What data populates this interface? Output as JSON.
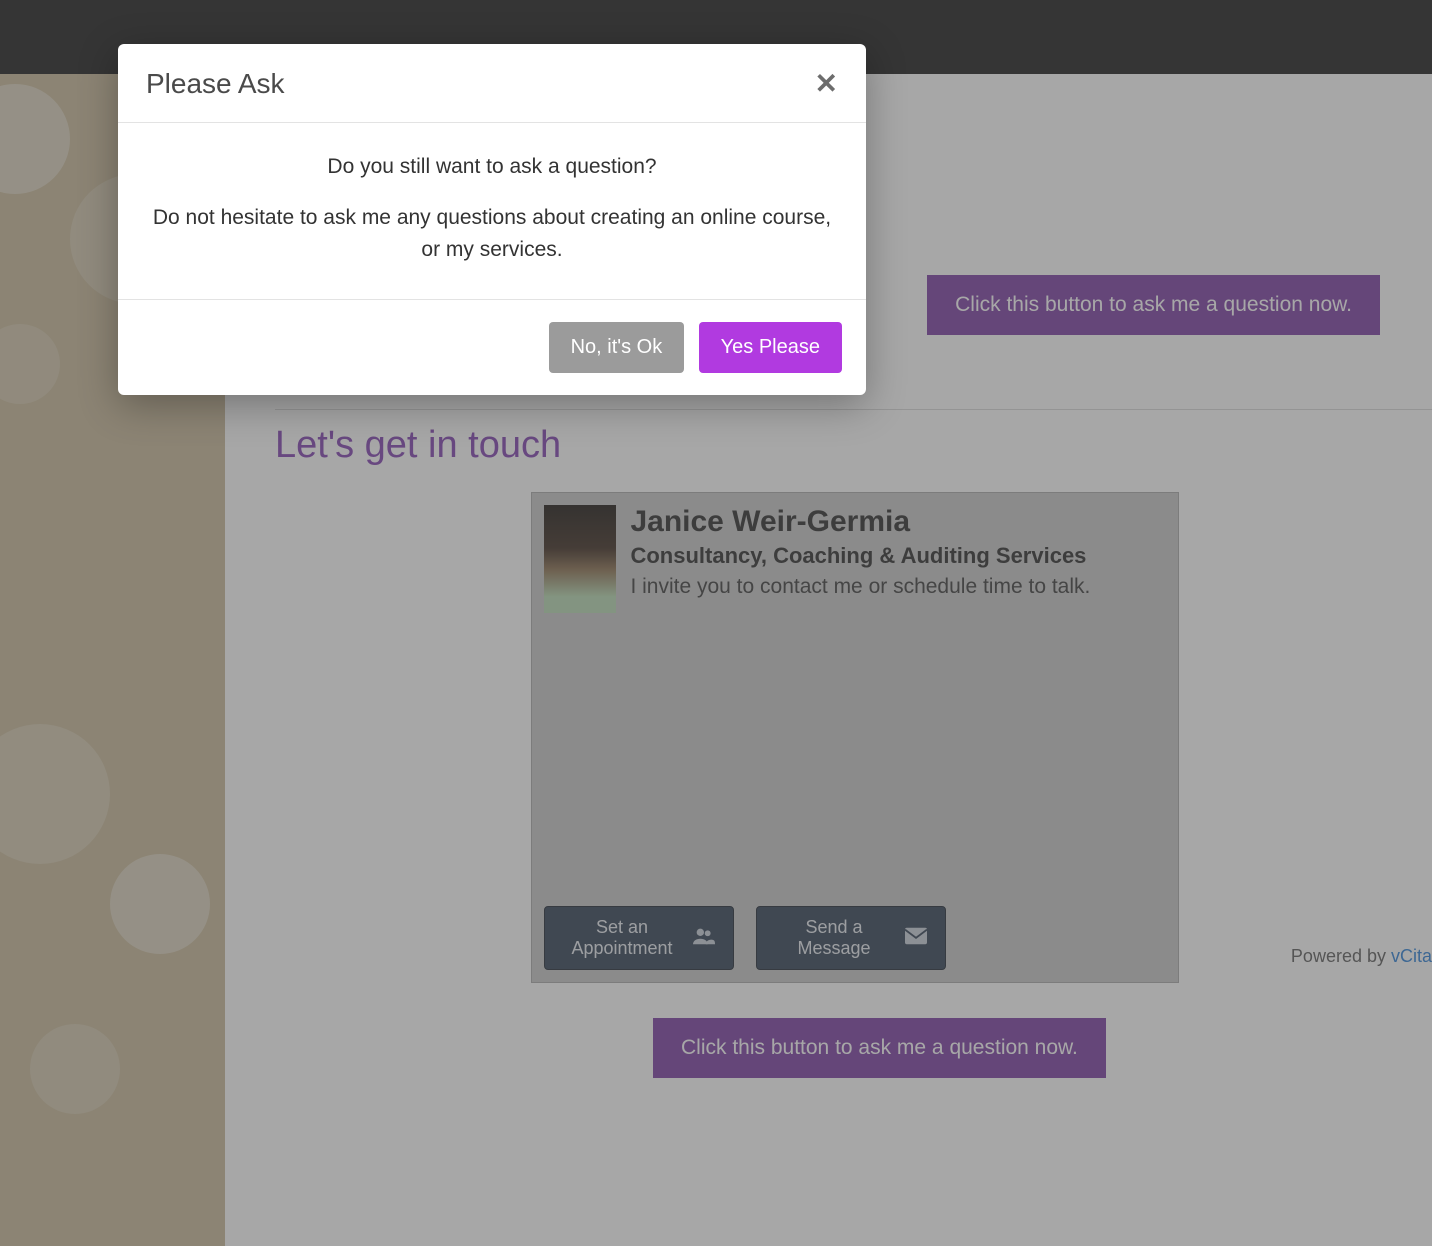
{
  "topbar": {
    "right_glyph": ""
  },
  "page": {
    "ask_button_label": "Click this button to ask me a question now.",
    "section_title": "Let's get in touch"
  },
  "contact_card": {
    "name": "Janice Weir-Germia",
    "subtitle": "Consultancy, Coaching & Auditing Services",
    "invite": "I invite you to contact me or schedule time to talk.",
    "appointment_btn": "Set an Appointment",
    "message_btn": "Send a Message"
  },
  "powered": {
    "prefix": "Powered by ",
    "link": "vCita"
  },
  "modal": {
    "title": "Please Ask",
    "line1": "Do you still want to ask a question?",
    "line2": "Do not hesitate to ask me any questions about creating an online course, or my services.",
    "no_label": "No, it's Ok",
    "yes_label": "Yes Please"
  }
}
